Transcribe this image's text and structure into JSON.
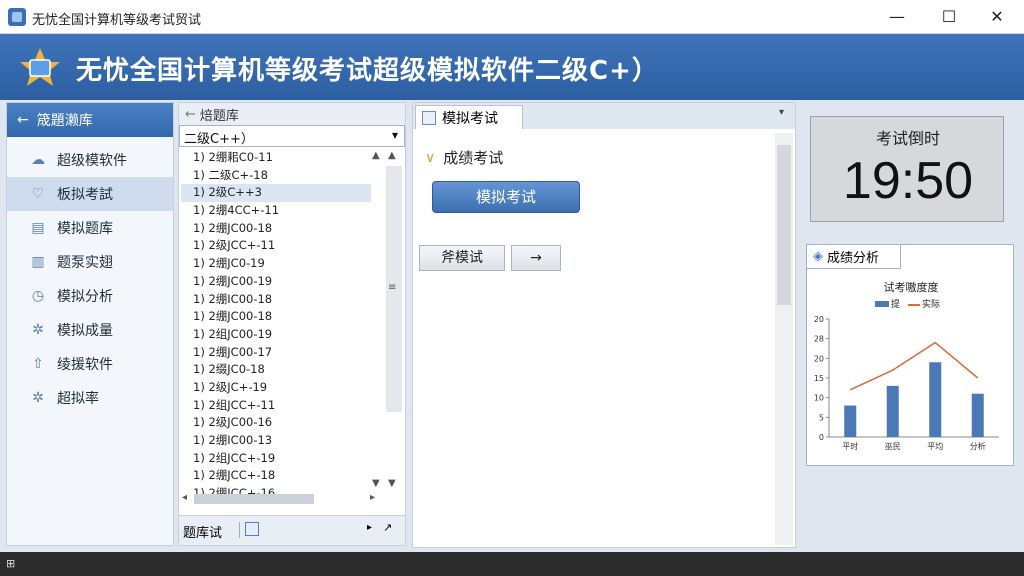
{
  "window": {
    "title": "无忧全国计算机等级考试贸试",
    "minimize_glyph": "—",
    "maximize_glyph": "☐",
    "close_glyph": "✕"
  },
  "banner": {
    "title": "无忧全国计算机等级考试超级模拟软件二级C+）"
  },
  "sidebar": {
    "back_label": "筬題濑库",
    "items": [
      {
        "label": "超级模软件",
        "icon": "cloud-icon",
        "active": false
      },
      {
        "label": "板拟考試",
        "icon": "heart-icon",
        "active": true
      },
      {
        "label": "模拟题库",
        "icon": "book-icon",
        "active": false
      },
      {
        "label": "题泵实翅",
        "icon": "chart-icon",
        "active": false
      },
      {
        "label": "模拟分析",
        "icon": "clock-icon",
        "active": false
      },
      {
        "label": "模拟成量",
        "icon": "gear-icon",
        "active": false
      },
      {
        "label": "绫援软件",
        "icon": "upload-icon",
        "active": false
      },
      {
        "label": "超拟率",
        "icon": "gear-icon",
        "active": false
      }
    ]
  },
  "question_panel": {
    "header": "焙题库",
    "select_value": "二级C++）",
    "rows": [
      "1) 2绷耜C0-11",
      "1) 二级C+-18",
      "1) 2级C++3",
      "1) 2绷4CC+-11",
      "1) 2绷JC00-18",
      "1) 2级JCC+-11",
      "1) 2绷JC0-19",
      "1) 2绷JC00-19",
      "1) 2绷IC00-18",
      "1) 2绷JC00-18",
      "1) 2组JC00-19",
      "1) 2绷JC00-17",
      "1) 2缀JC0-18",
      "1) 2级JC+-19",
      "1) 2组JCC+-11",
      "1) 2级JC00-16",
      "1) 2绷IC00-13",
      "1) 2组JCC+-19",
      "1) 2绷JCC+-18",
      "1) 2绷JCC+-16"
    ],
    "selected_index": 2,
    "footer_label": "题库试"
  },
  "center": {
    "tab_label": "模拟考试",
    "section_title": "成绩考试",
    "primary_button": "模拟考试",
    "secondary_button": "斧模试",
    "icon_button": "→"
  },
  "timer": {
    "label": "考试倒时",
    "value": "19:50"
  },
  "analysis": {
    "tab_label": "成绩分析",
    "legend_bar": "提",
    "legend_line": "实际"
  },
  "colors": {
    "accent": "#3a6fb4",
    "bar": "#4a79b5",
    "line": "#d96a3a"
  },
  "chart_data": {
    "type": "bar",
    "title": "试考嗷度度",
    "categories": [
      "平时",
      "巫民",
      "平均",
      "分析"
    ],
    "series": [
      {
        "name": "提",
        "type": "bar",
        "values": [
          8,
          13,
          19,
          11
        ]
      },
      {
        "name": "实际",
        "type": "line",
        "values": [
          12,
          17,
          24,
          15
        ]
      }
    ],
    "ylim": [
      0,
      30
    ],
    "yticks": [
      "0",
      "5",
      "10",
      "15",
      "20",
      "28",
      "20"
    ],
    "grid": false,
    "legend_position": "top-center"
  }
}
